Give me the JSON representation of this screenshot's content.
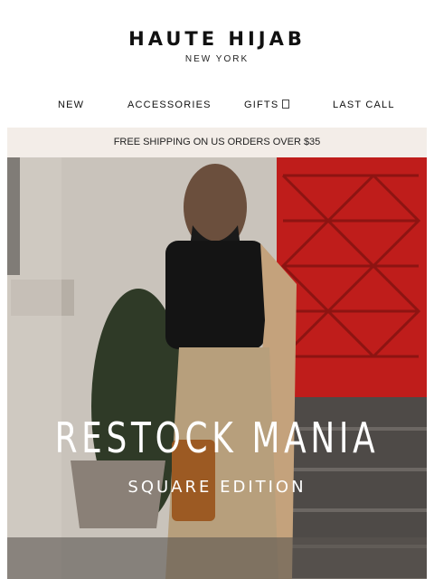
{
  "brand": {
    "name": "HAUTE HIJAB",
    "location": "NEW YORK"
  },
  "nav": {
    "items": [
      {
        "label": "NEW"
      },
      {
        "label": "ACCESSORIES"
      },
      {
        "label": "GIFTS"
      },
      {
        "label": "LAST CALL"
      }
    ]
  },
  "banner": {
    "text": "FREE SHIPPING ON US ORDERS OVER $35"
  },
  "hero": {
    "title": "RESTOCK MANIA",
    "subtitle": "SQUARE EDITION"
  },
  "colors": {
    "banner_bg": "#f3ede8",
    "door_red": "#c5201b",
    "text": "#111111"
  },
  "icons": {
    "gifts_chevron": "chevron-down-icon"
  }
}
